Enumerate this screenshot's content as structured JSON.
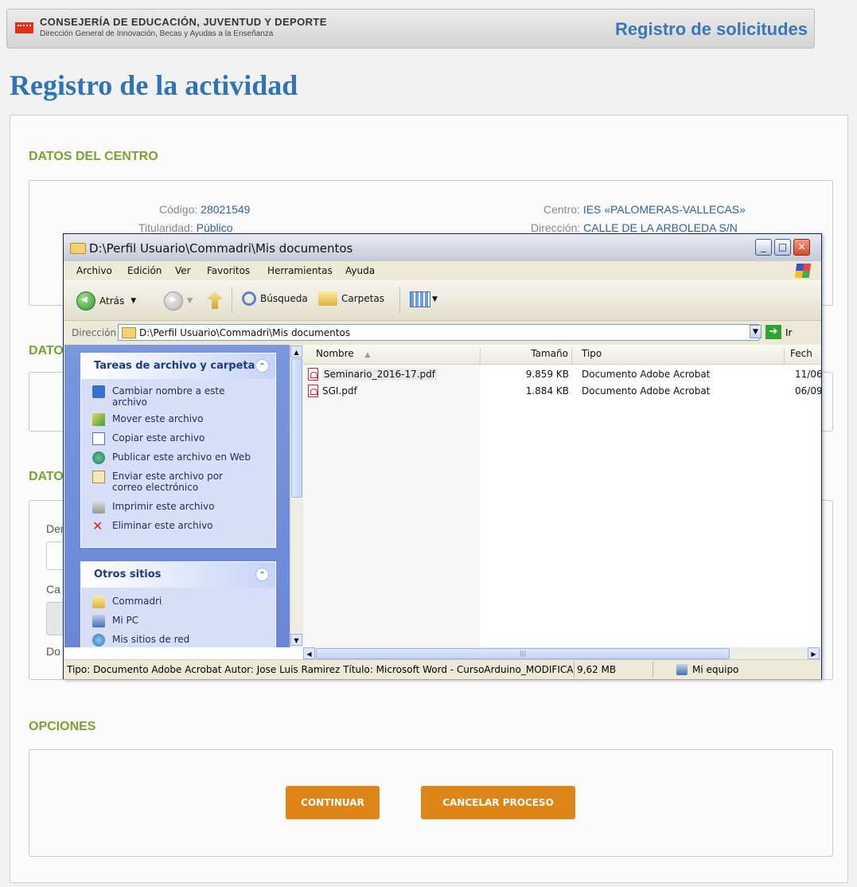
{
  "header": {
    "org_name": "CONSEJERÍA DE EDUCACIÓN, JUVENTUD Y DEPORTE",
    "org_sub": "Dirección General de Innovación, Becas y Ayudas a la Enseñanza",
    "app_title": "Registro de solicitudes",
    "brand_color": "#e0321b"
  },
  "page": {
    "title": "Registro de la actividad"
  },
  "centro": {
    "section_title": "DATOS DEL CENTRO",
    "codigo_label": "Código:",
    "codigo_value": "28021549",
    "centro_label": "Centro:",
    "centro_value": "IES «PALOMERAS-VALLECAS»",
    "titularidad_label": "Titularidad:",
    "titularidad_value": "Público",
    "direccion_label": "Dirección:",
    "direccion_value": "CALLE DE LA ARBOLEDA S/N"
  },
  "hidden_sections": {
    "s2_partial": "DATO",
    "s3_partial": "DATO",
    "f1_partial": "Der",
    "f2_partial": "Ca",
    "f3_partial": "Do"
  },
  "opciones": {
    "section_title": "OPCIONES",
    "continue_label": "CONTINUAR",
    "cancel_label": "CANCELAR PROCESO",
    "accent": "#dd8617"
  },
  "explorer": {
    "title": "D:\\Perfil Usuario\\Commadri\\Mis documentos",
    "menu": [
      "Archivo",
      "Edición",
      "Ver",
      "Favoritos",
      "Herramientas",
      "Ayuda"
    ],
    "toolbar": {
      "back": "Atrás",
      "search": "Búsqueda",
      "folders": "Carpetas"
    },
    "address_label": "Dirección",
    "address_value": "D:\\Perfil Usuario\\Commadri\\Mis documentos",
    "go_label": "Ir",
    "tasks": {
      "title": "Tareas de archivo y carpeta",
      "items": [
        "Cambiar nombre a este archivo",
        "Mover este archivo",
        "Copiar este archivo",
        "Publicar este archivo en Web",
        "Enviar este archivo por correo electrónico",
        "Imprimir este archivo",
        "Eliminar este archivo"
      ]
    },
    "other": {
      "title": "Otros sitios",
      "items": [
        "Commadri",
        "Mi PC",
        "Mis sitios de red"
      ]
    },
    "columns": [
      "Nombre",
      "Tamaño",
      "Tipo",
      "Fech"
    ],
    "files": [
      {
        "name": "Seminario_2016-17.pdf",
        "size": "9.859 KB",
        "type": "Documento Adobe Acrobat",
        "date": "11/06"
      },
      {
        "name": "SGI.pdf",
        "size": "1.884 KB",
        "type": "Documento Adobe Acrobat",
        "date": "06/09"
      }
    ],
    "status": {
      "info": "Tipo: Documento Adobe Acrobat Autor: Jose Luis Ramirez Título: Microsoft Word - CursoArduino_MODIFICADO",
      "size": "9,62 MB",
      "location": "Mi equipo"
    }
  }
}
